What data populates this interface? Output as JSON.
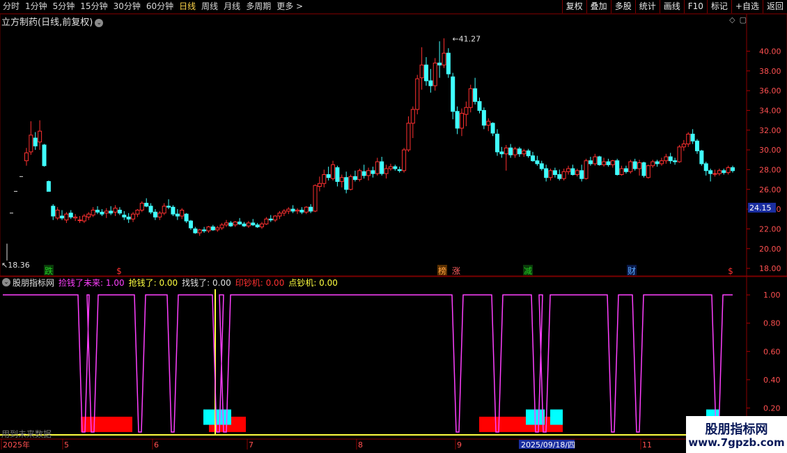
{
  "toolbar": {
    "periods": [
      "分时",
      "1分钟",
      "5分钟",
      "15分钟",
      "30分钟",
      "60分钟",
      "日线",
      "周线",
      "月线",
      "多周期",
      "更多 >"
    ],
    "active_period": "日线",
    "actions": [
      "复权",
      "叠加",
      "多股",
      "统计",
      "画线",
      "F10",
      "标记",
      "+自选",
      "返回"
    ]
  },
  "stock": {
    "title": "立方制药(日线,前复权)"
  },
  "main_chart": {
    "y_ticks": [
      "40.00",
      "38.00",
      "36.00",
      "34.00",
      "32.00",
      "30.00",
      "28.00",
      "26.00",
      "24.00",
      "22.00",
      "20.00",
      "18.00"
    ],
    "current_price_label": "24.15",
    "high_label": "41.27",
    "low_label": "18.36",
    "event_markers": [
      {
        "text": "跌",
        "color": "#22cc22",
        "bg": "#0a3a0a"
      },
      {
        "text": "$",
        "color": "#ff3030",
        "bg": ""
      },
      {
        "text": "榜",
        "color": "#ffa040",
        "bg": "#5a3000"
      },
      {
        "text": "涨",
        "color": "#ff6060",
        "bg": ""
      },
      {
        "text": "减",
        "color": "#22cc22",
        "bg": "#0a3a0a"
      },
      {
        "text": "财",
        "color": "#5aaaff",
        "bg": "#0a1a4a"
      },
      {
        "text": "$",
        "color": "#ff3030",
        "bg": ""
      }
    ]
  },
  "indicator": {
    "name": "股朋指标网",
    "legend": [
      {
        "label": "捡钱了未来: 1.00",
        "color": "#ff40ff"
      },
      {
        "label": "抢钱了: 0.00",
        "color": "#ffff40"
      },
      {
        "label": "找钱了: 0.00",
        "color": "#e0e0e0"
      },
      {
        "label": "印钞机: 0.00",
        "color": "#ff3030"
      },
      {
        "label": "点钞机: 0.00",
        "color": "#ffff40"
      }
    ],
    "y_ticks": [
      "1.00",
      "0.80",
      "0.60",
      "0.40",
      "0.20"
    ],
    "hint": "用到未来数据"
  },
  "date_axis": {
    "labels": [
      "2025年",
      "5",
      "6",
      "7",
      "8",
      "9",
      "11"
    ],
    "selected_date": "2025/09/18/四"
  },
  "watermark": {
    "line1": "股朋指标网",
    "line2": "www.7gpzb.com"
  },
  "chart_data": {
    "type": "candlestick",
    "y_range_main": [
      17.3,
      42.5
    ],
    "y_range_indicator": [
      0,
      1.05
    ],
    "colors": {
      "up": "#ff3030",
      "down": "#40ffff",
      "ma": "#ffffff",
      "signal": "#ff40ff"
    },
    "indicator_signal_dips": [
      120,
      133,
      201,
      248,
      313,
      323,
      657,
      714,
      771,
      782,
      880,
      916,
      1030
    ],
    "indicator_spike_index": 309,
    "indicator_boxes": [
      {
        "x0": 116,
        "x1": 190,
        "level": 0.03,
        "color": "#ff0000"
      },
      {
        "x0": 300,
        "x1": 353,
        "level": 0.03,
        "color": "#ff0000"
      },
      {
        "x0": 688,
        "x1": 808,
        "level": 0.03,
        "color": "#ff0000"
      },
      {
        "x0": 292,
        "x1": 332,
        "level": 0.16,
        "color": "#00ffff"
      },
      {
        "x0": 755,
        "x1": 782,
        "level": 0.16,
        "color": "#00ffff"
      },
      {
        "x0": 790,
        "x1": 808,
        "level": 0.16,
        "color": "#00ffff"
      },
      {
        "x0": 1014,
        "x1": 1033,
        "level": 0.16,
        "color": "#00ffff"
      }
    ],
    "candles": [
      [
        28.9,
        30.2,
        28.4,
        29.7
      ],
      [
        29.8,
        32.9,
        29.5,
        31.5
      ],
      [
        31.2,
        31.8,
        30.0,
        30.4
      ],
      [
        30.8,
        33.0,
        30.0,
        31.9
      ],
      [
        30.5,
        30.6,
        28.3,
        28.4
      ],
      [
        26.8,
        26.9,
        25.8,
        25.8
      ],
      [
        24.3,
        24.5,
        22.9,
        23.3
      ],
      [
        23.1,
        24.2,
        22.9,
        23.9
      ],
      [
        23.3,
        23.9,
        22.9,
        23.1
      ],
      [
        22.9,
        23.7,
        22.6,
        23.5
      ],
      [
        23.6,
        23.9,
        23.0,
        23.2
      ],
      [
        23.1,
        23.5,
        22.8,
        23.2
      ],
      [
        22.9,
        23.3,
        22.6,
        22.9
      ],
      [
        22.8,
        23.5,
        22.6,
        23.3
      ],
      [
        23.2,
        23.7,
        22.9,
        23.5
      ],
      [
        23.4,
        24.2,
        23.2,
        23.9
      ],
      [
        23.9,
        24.3,
        23.5,
        23.7
      ],
      [
        23.7,
        24.0,
        23.3,
        23.5
      ],
      [
        23.6,
        24.1,
        23.1,
        23.8
      ],
      [
        23.8,
        24.3,
        23.4,
        23.6
      ],
      [
        23.7,
        24.4,
        23.3,
        24.1
      ],
      [
        23.9,
        24.2,
        23.4,
        23.6
      ],
      [
        23.4,
        23.8,
        22.9,
        23.2
      ],
      [
        23.2,
        23.6,
        22.6,
        23.0
      ],
      [
        23.0,
        23.7,
        22.7,
        23.5
      ],
      [
        23.5,
        24.0,
        23.2,
        23.9
      ],
      [
        23.9,
        24.8,
        23.7,
        24.6
      ],
      [
        24.6,
        25.1,
        24.2,
        24.3
      ],
      [
        24.3,
        24.6,
        23.5,
        23.7
      ],
      [
        23.7,
        24.0,
        22.9,
        23.2
      ],
      [
        23.2,
        23.8,
        22.9,
        23.6
      ],
      [
        23.6,
        24.6,
        23.4,
        24.3
      ],
      [
        24.3,
        25.0,
        24.0,
        24.2
      ],
      [
        24.2,
        24.4,
        23.3,
        23.5
      ],
      [
        23.5,
        24.0,
        22.9,
        23.3
      ],
      [
        23.3,
        24.1,
        23.0,
        23.9
      ],
      [
        23.5,
        23.6,
        22.6,
        22.8
      ],
      [
        22.8,
        22.9,
        21.9,
        22.1
      ],
      [
        22.0,
        22.2,
        21.5,
        21.6
      ],
      [
        21.6,
        22.0,
        21.3,
        21.9
      ],
      [
        21.9,
        22.2,
        21.6,
        21.8
      ],
      [
        21.8,
        22.3,
        21.6,
        22.2
      ],
      [
        22.2,
        22.4,
        21.8,
        21.9
      ],
      [
        21.9,
        22.3,
        21.7,
        22.1
      ],
      [
        22.1,
        22.6,
        21.9,
        22.4
      ],
      [
        22.4,
        22.9,
        22.2,
        22.6
      ],
      [
        22.6,
        22.8,
        22.2,
        22.3
      ],
      [
        22.4,
        22.8,
        22.2,
        22.7
      ],
      [
        22.7,
        23.1,
        22.4,
        22.5
      ],
      [
        22.5,
        22.7,
        22.2,
        22.3
      ],
      [
        22.3,
        22.8,
        22.1,
        22.6
      ],
      [
        22.6,
        23.0,
        22.3,
        22.4
      ],
      [
        22.4,
        22.6,
        22.1,
        22.2
      ],
      [
        22.2,
        22.7,
        22.0,
        22.5
      ],
      [
        22.5,
        23.2,
        22.4,
        23.0
      ],
      [
        23.0,
        23.4,
        22.7,
        22.9
      ],
      [
        22.9,
        23.4,
        22.7,
        23.3
      ],
      [
        23.3,
        23.8,
        23.0,
        23.6
      ],
      [
        23.6,
        24.0,
        23.3,
        23.8
      ],
      [
        23.8,
        24.2,
        23.5,
        24.0
      ],
      [
        24.0,
        24.4,
        23.6,
        23.8
      ],
      [
        23.8,
        24.1,
        23.5,
        23.9
      ],
      [
        23.9,
        24.2,
        23.5,
        23.7
      ],
      [
        23.7,
        24.3,
        23.5,
        24.2
      ],
      [
        24.2,
        24.5,
        23.6,
        23.8
      ],
      [
        23.8,
        26.5,
        23.7,
        26.4
      ],
      [
        26.3,
        27.3,
        25.8,
        26.6
      ],
      [
        26.6,
        28.0,
        26.2,
        27.5
      ],
      [
        27.5,
        28.3,
        26.9,
        27.2
      ],
      [
        27.1,
        28.9,
        26.9,
        28.5
      ],
      [
        28.2,
        28.4,
        26.3,
        26.8
      ],
      [
        26.8,
        27.5,
        26.2,
        27.2
      ],
      [
        27.2,
        27.8,
        25.6,
        26.0
      ],
      [
        26.0,
        27.5,
        25.9,
        27.3
      ],
      [
        27.3,
        27.9,
        26.8,
        27.0
      ],
      [
        27.0,
        28.1,
        26.8,
        27.9
      ],
      [
        27.8,
        28.5,
        27.1,
        27.4
      ],
      [
        27.4,
        28.2,
        26.9,
        27.9
      ],
      [
        27.9,
        28.3,
        27.2,
        27.6
      ],
      [
        27.6,
        29.2,
        27.4,
        28.8
      ],
      [
        28.8,
        29.3,
        27.4,
        27.6
      ],
      [
        27.6,
        28.5,
        27.1,
        28.1
      ],
      [
        28.1,
        28.6,
        27.9,
        28.3
      ],
      [
        28.3,
        28.5,
        27.9,
        28.1
      ],
      [
        28.0,
        28.3,
        27.7,
        27.9
      ],
      [
        27.9,
        30.2,
        27.7,
        30.0
      ],
      [
        30.0,
        33.4,
        29.8,
        32.7
      ],
      [
        32.7,
        34.4,
        31.2,
        34.1
      ],
      [
        34.1,
        37.6,
        33.6,
        37.2
      ],
      [
        37.3,
        40.4,
        36.1,
        38.6
      ],
      [
        38.6,
        39.4,
        36.5,
        37.0
      ],
      [
        37.0,
        38.2,
        35.8,
        36.5
      ],
      [
        36.5,
        39.3,
        36.0,
        38.8
      ],
      [
        38.8,
        41.0,
        37.3,
        38.6
      ],
      [
        38.6,
        41.3,
        38.3,
        39.8
      ],
      [
        39.8,
        40.3,
        37.3,
        37.7
      ],
      [
        37.4,
        37.8,
        33.1,
        33.9
      ],
      [
        33.9,
        34.4,
        31.6,
        32.2
      ],
      [
        32.2,
        34.2,
        31.4,
        33.7
      ],
      [
        33.6,
        34.9,
        32.4,
        34.3
      ],
      [
        34.3,
        36.6,
        33.8,
        36.2
      ],
      [
        36.2,
        37.3,
        34.6,
        34.9
      ],
      [
        34.9,
        35.3,
        33.7,
        34.0
      ],
      [
        34.0,
        34.3,
        32.1,
        32.5
      ],
      [
        32.5,
        33.2,
        31.9,
        32.9
      ],
      [
        32.7,
        32.8,
        31.4,
        31.7
      ],
      [
        31.6,
        32.1,
        29.4,
        29.8
      ],
      [
        29.8,
        30.3,
        29.2,
        29.6
      ],
      [
        29.6,
        30.5,
        27.9,
        30.2
      ],
      [
        30.2,
        30.6,
        29.2,
        29.5
      ],
      [
        29.5,
        30.3,
        29.2,
        30.1
      ],
      [
        30.1,
        30.3,
        29.3,
        29.6
      ],
      [
        29.6,
        30.1,
        29.3,
        29.9
      ],
      [
        29.9,
        30.1,
        29.2,
        29.4
      ],
      [
        29.4,
        29.8,
        28.8,
        28.9
      ],
      [
        28.9,
        29.4,
        28.4,
        28.6
      ],
      [
        28.6,
        28.9,
        27.9,
        28.1
      ],
      [
        28.1,
        28.5,
        26.8,
        27.2
      ],
      [
        27.2,
        28.1,
        26.9,
        27.9
      ],
      [
        27.9,
        28.2,
        27.2,
        27.5
      ],
      [
        27.5,
        28.0,
        26.9,
        27.1
      ],
      [
        27.1,
        28.1,
        26.9,
        27.8
      ],
      [
        27.8,
        28.4,
        27.5,
        28.1
      ],
      [
        28.1,
        28.5,
        27.4,
        27.5
      ],
      [
        27.5,
        28.1,
        27.3,
        27.9
      ],
      [
        27.9,
        28.5,
        26.8,
        27.1
      ],
      [
        27.1,
        29.1,
        27.0,
        28.9
      ],
      [
        28.9,
        29.3,
        28.4,
        28.6
      ],
      [
        28.6,
        29.6,
        28.4,
        29.3
      ],
      [
        29.3,
        29.4,
        28.4,
        28.5
      ],
      [
        28.5,
        29.2,
        28.3,
        28.8
      ],
      [
        28.8,
        29.1,
        28.3,
        28.5
      ],
      [
        28.5,
        29.0,
        28.2,
        28.9
      ],
      [
        28.9,
        29.1,
        27.4,
        27.5
      ],
      [
        27.5,
        28.4,
        27.4,
        28.1
      ],
      [
        28.1,
        28.4,
        27.6,
        27.8
      ],
      [
        27.8,
        29.0,
        27.6,
        28.8
      ],
      [
        28.8,
        29.1,
        27.9,
        28.1
      ],
      [
        28.1,
        29.0,
        27.4,
        28.7
      ],
      [
        28.7,
        28.8,
        27.2,
        27.4
      ],
      [
        27.2,
        28.5,
        27.1,
        28.4
      ],
      [
        28.4,
        29.0,
        28.2,
        28.8
      ],
      [
        28.8,
        29.0,
        28.3,
        28.6
      ],
      [
        28.6,
        29.2,
        28.4,
        28.9
      ],
      [
        28.9,
        29.6,
        28.6,
        29.3
      ],
      [
        29.3,
        29.7,
        28.6,
        28.9
      ],
      [
        28.9,
        29.2,
        28.5,
        28.8
      ],
      [
        28.8,
        30.5,
        28.7,
        30.3
      ],
      [
        30.3,
        31.0,
        29.9,
        30.6
      ],
      [
        30.6,
        31.8,
        30.3,
        31.6
      ],
      [
        31.6,
        32.1,
        30.6,
        30.9
      ],
      [
        30.9,
        31.1,
        29.6,
        29.9
      ],
      [
        29.9,
        30.0,
        28.4,
        28.6
      ],
      [
        28.6,
        28.8,
        27.4,
        27.9
      ],
      [
        27.9,
        28.1,
        26.8,
        27.6
      ],
      [
        27.6,
        28.0,
        27.3,
        27.6
      ],
      [
        27.6,
        28.1,
        27.4,
        27.9
      ],
      [
        27.9,
        28.1,
        27.5,
        27.7
      ],
      [
        27.7,
        28.4,
        27.5,
        28.2
      ],
      [
        28.2,
        28.4,
        27.7,
        27.9
      ]
    ]
  }
}
